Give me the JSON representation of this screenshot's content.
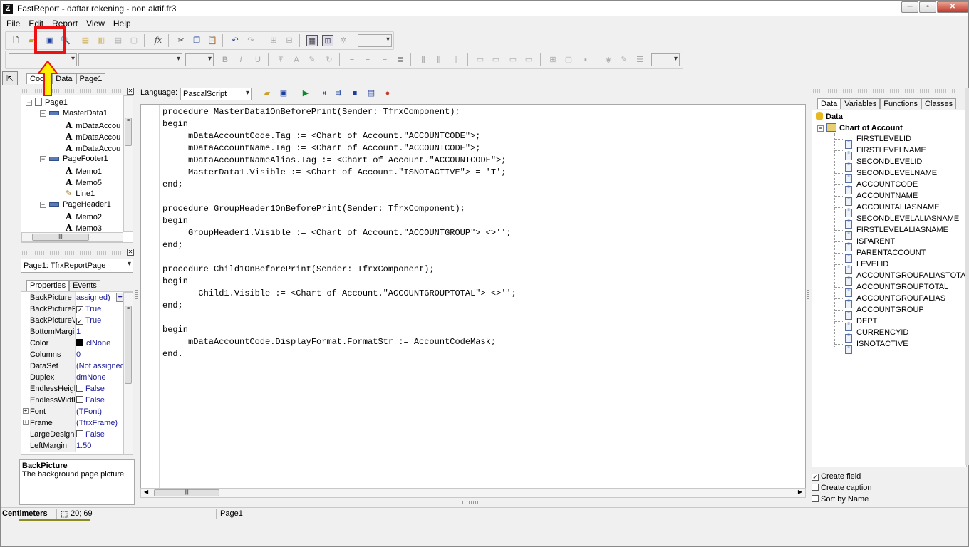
{
  "window": {
    "title": "FastReport - daftar rekening - non aktif.fr3",
    "app_icon": "Z"
  },
  "menu": [
    "File",
    "Edit",
    "Report",
    "View",
    "Help"
  ],
  "design_tabs": [
    "Code",
    "Data",
    "Page1"
  ],
  "object_tree": {
    "items": [
      {
        "label": "Page1",
        "level": 0,
        "icon": "page-icon"
      },
      {
        "label": "MasterData1",
        "level": 1,
        "icon": "band-icon"
      },
      {
        "label": "mDataAccou",
        "level": 2,
        "icon": "text-icon"
      },
      {
        "label": "mDataAccou",
        "level": 2,
        "icon": "text-icon"
      },
      {
        "label": "mDataAccou",
        "level": 2,
        "icon": "text-icon"
      },
      {
        "label": "PageFooter1",
        "level": 1,
        "icon": "band-icon"
      },
      {
        "label": "Memo1",
        "level": 2,
        "icon": "text-icon"
      },
      {
        "label": "Memo5",
        "level": 2,
        "icon": "text-icon"
      },
      {
        "label": "Line1",
        "level": 2,
        "icon": "line-icon"
      },
      {
        "label": "PageHeader1",
        "level": 1,
        "icon": "band-icon"
      },
      {
        "label": "Memo2",
        "level": 2,
        "icon": "text-icon"
      },
      {
        "label": "Memo3",
        "level": 2,
        "icon": "text-icon"
      }
    ]
  },
  "object_selector": "Page1: TfrxReportPage",
  "inspector_tabs": [
    "Properties",
    "Events"
  ],
  "properties": [
    {
      "name": "BackPicture",
      "value": "assigned)",
      "check": null,
      "expand": false,
      "ellipsis": true
    },
    {
      "name": "BackPicturePr",
      "value": "True",
      "check": true,
      "expand": false
    },
    {
      "name": "BackPictureVi",
      "value": "True",
      "check": true,
      "expand": false
    },
    {
      "name": "BottomMargin",
      "value": "1",
      "check": null,
      "expand": false
    },
    {
      "name": "Color",
      "value": "clNone",
      "check": null,
      "expand": false,
      "swatch": "#000000"
    },
    {
      "name": "Columns",
      "value": "0",
      "check": null,
      "expand": false
    },
    {
      "name": "DataSet",
      "value": "(Not assigned",
      "check": null,
      "expand": false
    },
    {
      "name": "Duplex",
      "value": "dmNone",
      "check": null,
      "expand": false
    },
    {
      "name": "EndlessHeigh",
      "value": "False",
      "check": false,
      "expand": false
    },
    {
      "name": "EndlessWidth",
      "value": "False",
      "check": false,
      "expand": false
    },
    {
      "name": "Font",
      "value": "(TFont)",
      "check": null,
      "expand": true
    },
    {
      "name": "Frame",
      "value": "(TfrxFrame)",
      "check": null,
      "expand": true
    },
    {
      "name": "LargeDesign",
      "value": "False",
      "check": false,
      "expand": false
    },
    {
      "name": "LeftMargin",
      "value": "1.50",
      "check": null,
      "expand": false
    }
  ],
  "property_help": {
    "title": "BackPicture",
    "text": "The background page picture"
  },
  "code_toolbar": {
    "language_label": "Language:",
    "language": "PascalScript"
  },
  "code_lines": [
    "procedure MasterData1OnBeforePrint(Sender: TfrxComponent);",
    "begin",
    "     mDataAccountCode.Tag := <Chart of Account.\"ACCOUNTCODE\">;",
    "     mDataAccountName.Tag := <Chart of Account.\"ACCOUNTCODE\">;",
    "     mDataAccountNameAlias.Tag := <Chart of Account.\"ACCOUNTCODE\">;",
    "     MasterData1.Visible := <Chart of Account.\"ISNOTACTIVE\"> = 'T';",
    "end;",
    "",
    "procedure GroupHeader1OnBeforePrint(Sender: TfrxComponent);",
    "begin",
    "     GroupHeader1.Visible := <Chart of Account.\"ACCOUNTGROUP\"> <>'';",
    "end;",
    "",
    "procedure Child1OnBeforePrint(Sender: TfrxComponent);",
    "begin",
    "       Child1.Visible := <Chart of Account.\"ACCOUNTGROUPTOTAL\"> <>'';",
    "end;",
    "",
    "begin",
    "     mDataAccountCode.DisplayFormat.FormatStr := AccountCodeMask;",
    "end."
  ],
  "data_tabs": [
    "Data",
    "Variables",
    "Functions",
    "Classes"
  ],
  "data_tree": {
    "root": "Data",
    "dataset": "Chart of Account",
    "fields": [
      "FIRSTLEVELID",
      "FIRSTLEVELNAME",
      "SECONDLEVELID",
      "SECONDLEVELNAME",
      "ACCOUNTCODE",
      "ACCOUNTNAME",
      "ACCOUNTALIASNAME",
      "SECONDLEVELALIASNAME",
      "FIRSTLEVELALIASNAME",
      "ISPARENT",
      "PARENTACCOUNT",
      "LEVELID",
      "ACCOUNTGROUPALIASTOTAL",
      "ACCOUNTGROUPTOTAL",
      "ACCOUNTGROUPALIAS",
      "ACCOUNTGROUP",
      "DEPT",
      "CURRENCYID",
      "ISNOTACTIVE"
    ]
  },
  "data_options": [
    {
      "label": "Create field",
      "checked": true
    },
    {
      "label": "Create caption",
      "checked": false
    },
    {
      "label": "Sort by Name",
      "checked": false
    }
  ],
  "status": {
    "units": "Centimeters",
    "coords": "20; 69",
    "page": "Page1"
  },
  "colors": {
    "highlight": "#ee1111",
    "arrow": "#ffee00"
  }
}
